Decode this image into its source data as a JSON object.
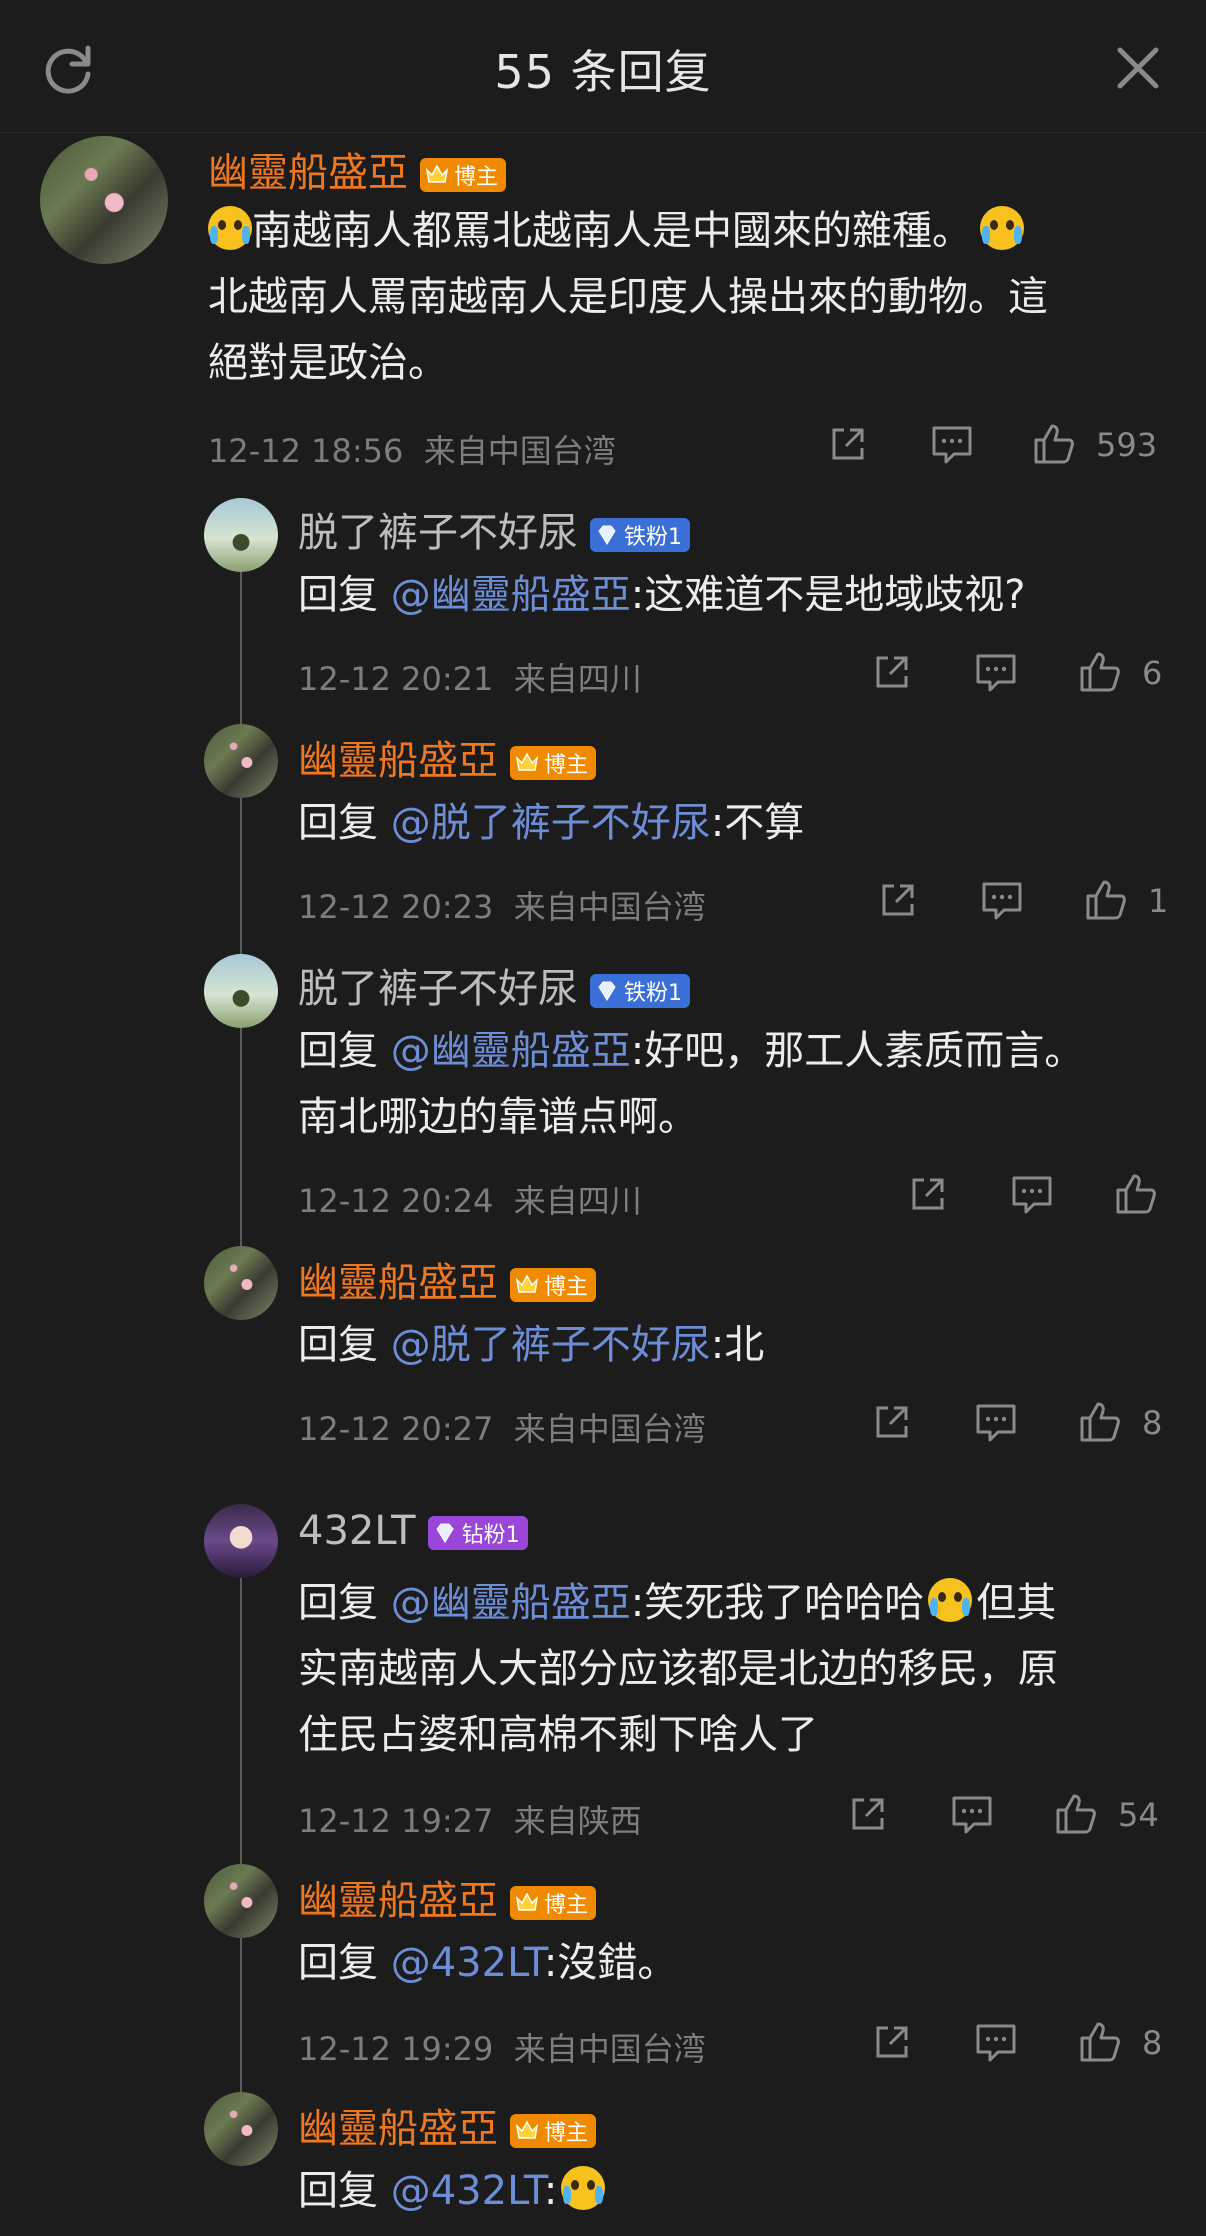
{
  "header": {
    "title": "55 条回复"
  },
  "main_comment": {
    "author": "幽靈船盛亞",
    "badge": "博主",
    "text_part1": "南越南人都罵北越南人是中國來的雜種。",
    "text_part2": "北越南人罵南越南人是印度人操出來的動物。這",
    "text_line3": "絕對是政治。",
    "time": "12-12 18:56",
    "location": "来自中国台湾",
    "likes": "593"
  },
  "thread1": {
    "r1": {
      "author": "脱了裤子不好尿",
      "badge": "铁粉1",
      "prefix": "回复 ",
      "mention": "@幽靈船盛亞",
      "text": ":这难道不是地域歧视?",
      "time": "12-12 20:21",
      "location": "来自四川",
      "likes": "6"
    },
    "r2": {
      "author": "幽靈船盛亞",
      "badge": "博主",
      "prefix": "回复 ",
      "mention": "@脱了裤子不好尿",
      "text": ":不算",
      "time": "12-12 20:23",
      "location": "来自中国台湾",
      "likes": "1"
    },
    "r3": {
      "author": "脱了裤子不好尿",
      "badge": "铁粉1",
      "prefix": "回复 ",
      "mention": "@幽靈船盛亞",
      "text": ":好吧，那工人素质而言。",
      "text2": "南北哪边的靠谱点啊。",
      "time": "12-12 20:24",
      "location": "来自四川",
      "likes": ""
    },
    "r4": {
      "author": "幽靈船盛亞",
      "badge": "博主",
      "prefix": "回复 ",
      "mention": "@脱了裤子不好尿",
      "text": ":北",
      "time": "12-12 20:27",
      "location": "来自中国台湾",
      "likes": "8"
    }
  },
  "thread2": {
    "r1": {
      "author": "432LT",
      "badge": "钻粉1",
      "prefix": "回复 ",
      "mention": "@幽靈船盛亞",
      "text": ":笑死我了哈哈哈",
      "text_after": "但其",
      "text2": "实南越南人大部分应该都是北边的移民，原",
      "text3": "住民占婆和高棉不剩下啥人了",
      "time": "12-12 19:27",
      "location": "来自陕西",
      "likes": "54"
    },
    "r2": {
      "author": "幽靈船盛亞",
      "badge": "博主",
      "prefix": "回复 ",
      "mention": "@432LT",
      "text": ":沒錯。",
      "time": "12-12 19:29",
      "location": "来自中国台湾",
      "likes": "8"
    },
    "r3": {
      "author": "幽靈船盛亞",
      "badge": "博主",
      "prefix": "回复 ",
      "mention": "@432LT",
      "text": ":"
    }
  },
  "icons": {
    "refresh": "refresh-icon",
    "close": "close-icon",
    "share": "share-icon",
    "comment": "comment-icon",
    "like": "like-icon"
  },
  "colors": {
    "author_host": "#ee7722",
    "mention": "#6d8ed6",
    "badge_host": "#f08a00",
    "badge_iron": "#3a6fd8",
    "badge_diamond": "#9a46d8",
    "background": "#1c1c1c"
  }
}
